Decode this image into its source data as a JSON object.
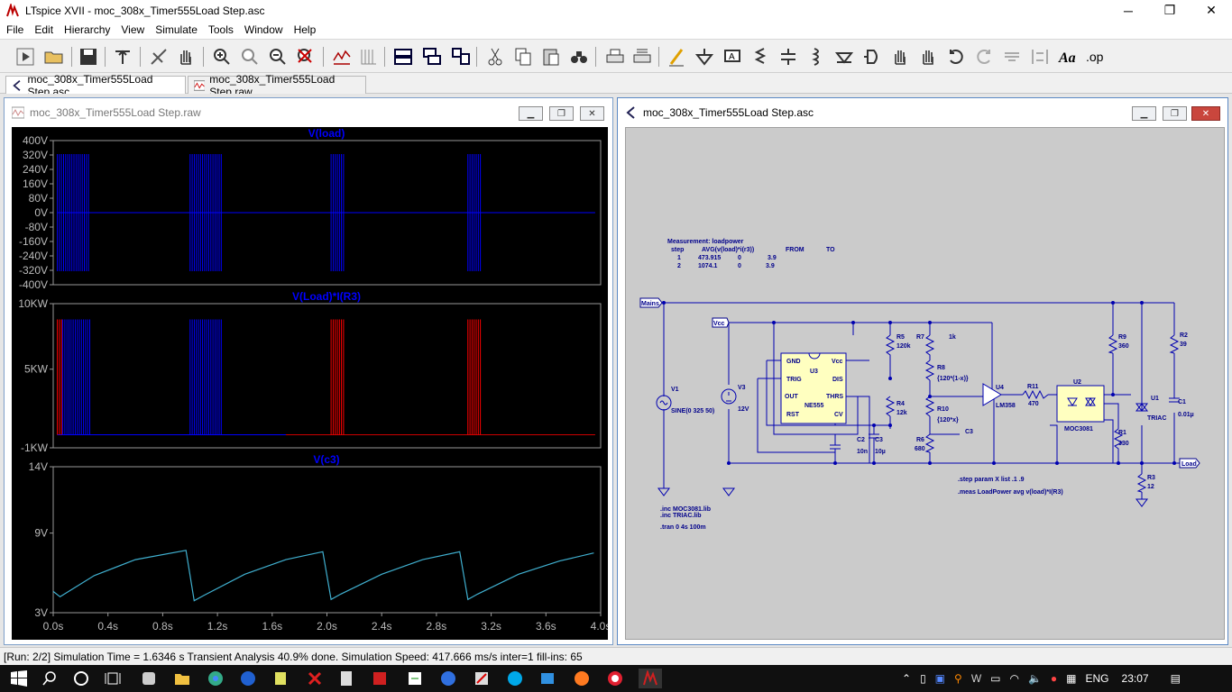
{
  "app": {
    "title": "LTspice XVII - moc_308x_Timer555Load Step.asc"
  },
  "menu": [
    "File",
    "Edit",
    "Hierarchy",
    "View",
    "Simulate",
    "Tools",
    "Window",
    "Help"
  ],
  "tabs": [
    {
      "label": "moc_308x_Timer555Load Step.asc",
      "active": true
    },
    {
      "label": "moc_308x_Timer555Load Step.raw",
      "active": false
    }
  ],
  "waveform_window": {
    "title": "moc_308x_Timer555Load Step.raw",
    "pane1": {
      "title": "V(load)",
      "yticks": [
        "400V",
        "320V",
        "240V",
        "160V",
        "80V",
        "0V",
        "-80V",
        "-160V",
        "-240V",
        "-320V",
        "-400V"
      ]
    },
    "pane2": {
      "title": "V(Load)*I(R3)",
      "yticks": [
        "10KW",
        "5KW",
        "-1KW"
      ]
    },
    "pane3": {
      "title": "V(c3)",
      "yticks": [
        "14V",
        "9V",
        "3V"
      ]
    },
    "xticks": [
      "0.0s",
      "0.4s",
      "0.8s",
      "1.2s",
      "1.6s",
      "2.0s",
      "2.4s",
      "2.8s",
      "3.2s",
      "3.6s",
      "4.0s"
    ]
  },
  "schematic_window": {
    "title": "moc_308x_Timer555Load Step.asc",
    "meas": {
      "heading": "Measurement: loadpower",
      "columns": [
        "step",
        "AVG(v(load)*i(r3))",
        "FROM",
        "TO"
      ],
      "rows": [
        [
          "1",
          "473.915",
          "0",
          "3.9"
        ],
        [
          "2",
          "1074.1",
          "0",
          "3.9"
        ]
      ]
    },
    "labels": {
      "mains": "Mains",
      "vcc": "Vcc",
      "load": "Load",
      "v1": "V1",
      "v1val": "SINE(0 325 50)",
      "v3": "V3",
      "v3val": "12V",
      "u3": "U3",
      "u3part": "NE555",
      "gnd": "GND",
      "trig": "TRIG",
      "out": "OUT",
      "rst": "RST",
      "vccpin": "Vcc",
      "dis": "DIS",
      "thrs": "THRS",
      "cv": "CV",
      "r5": "R5",
      "r5v": "120k",
      "r4": "R4",
      "r4v": "12k",
      "r7": "R7",
      "r7v": "1k",
      "r8": "R8",
      "r8v": "{120*(1-x)}",
      "r10": "R10",
      "r10v": "{120*x}",
      "r6": "R6",
      "r6v": "680",
      "c2": "C2",
      "c2v": "10n",
      "c3": "C3",
      "c3v": "10µ",
      "c3node": "C3",
      "u4": "U4",
      "u4part": "LM358",
      "r11": "R11",
      "r11v": "470",
      "u2": "U2",
      "u2part": "MOC3081",
      "r9": "R9",
      "r9v": "360",
      "r1": "R1",
      "r1v": "330",
      "u1": "U1",
      "u1part": "TRIAC",
      "r2": "R2",
      "r2v": "39",
      "c1": "C1",
      "c1v": "0.01µ",
      "r3": "R3",
      "r3v": "12",
      "dir1": ".inc MOC3081.lib",
      "dir2": ".inc TRIAC.lib",
      "dir3": ".tran 0 4s 100m",
      "step": ".step param X list .1 .9",
      "measdir": ".meas LoadPower avg v(load)*I(R3)"
    }
  },
  "status": "[Run: 2/2] Simulation Time = 1.6346 s  Transient Analysis 40.9% done. Simulation Speed: 417.666 ms/s inter=1 fill-ins: 65",
  "tray": {
    "lang": "ENG",
    "time": "23:07"
  },
  "chart_data": [
    {
      "type": "line",
      "title": "V(load)",
      "x_unit": "s",
      "ylim": [
        -400,
        400
      ],
      "xlim": [
        0,
        4
      ],
      "series": [
        {
          "name": "V(load)",
          "color": "#0000ff",
          "bursts": [
            {
              "from": 0.03,
              "to": 0.27,
              "amplitude": 325
            },
            {
              "from": 1.0,
              "to": 1.23,
              "amplitude": 325
            },
            {
              "from": 2.03,
              "to": 2.13,
              "amplitude": 325
            },
            {
              "from": 3.03,
              "to": 3.13,
              "amplitude": 325
            }
          ]
        }
      ]
    },
    {
      "type": "line",
      "title": "V(Load)*I(R3)",
      "ylim": [
        -1000,
        10000
      ],
      "xlim": [
        0,
        4
      ],
      "series": [
        {
          "name": "step 1",
          "color": "#ff0000",
          "bursts": [
            {
              "from": 0.03,
              "to": 0.07,
              "peak": 8800
            },
            {
              "from": 2.03,
              "to": 2.13,
              "peak": 8800
            },
            {
              "from": 3.03,
              "to": 3.13,
              "peak": 8800
            }
          ]
        },
        {
          "name": "step 2",
          "color": "#0000ff",
          "bursts": [
            {
              "from": 0.07,
              "to": 0.27,
              "peak": 8800
            },
            {
              "from": 1.0,
              "to": 1.23,
              "peak": 8800
            }
          ]
        }
      ]
    },
    {
      "type": "line",
      "title": "V(c3)",
      "ylim": [
        3,
        14
      ],
      "xlim": [
        0,
        4
      ],
      "series": [
        {
          "name": "V(c3)",
          "color": "#40b0d0",
          "x": [
            0.0,
            0.05,
            0.3,
            0.6,
            0.97,
            1.03,
            1.1,
            1.4,
            1.7,
            1.97,
            2.03,
            2.1,
            2.4,
            2.7,
            2.97,
            3.03,
            3.1,
            3.4,
            3.7,
            3.95
          ],
          "y": [
            4.6,
            4.2,
            5.8,
            7.0,
            7.7,
            3.9,
            4.3,
            5.9,
            7.0,
            7.6,
            4.0,
            4.4,
            5.9,
            7.0,
            7.6,
            4.0,
            4.4,
            5.9,
            6.9,
            7.5
          ]
        }
      ]
    }
  ]
}
